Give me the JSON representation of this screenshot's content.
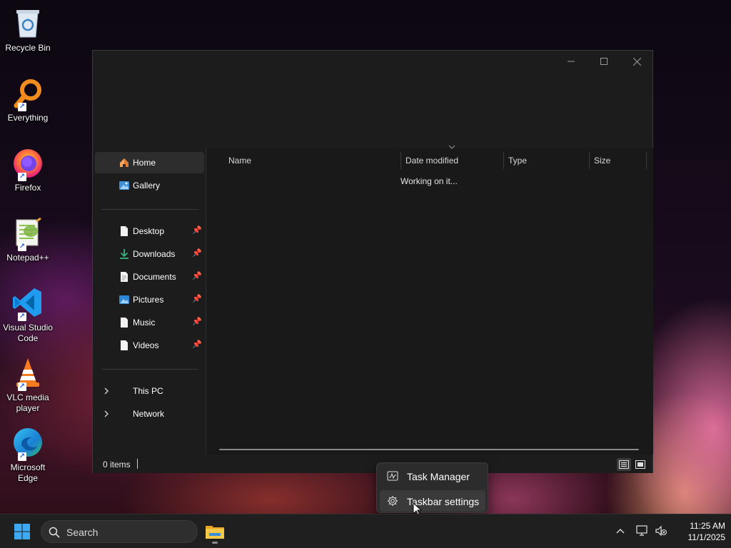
{
  "desktop": {
    "icons": [
      {
        "label": "Recycle Bin",
        "icon": "recycle-bin-icon"
      },
      {
        "label": "Everything",
        "icon": "everything-icon"
      },
      {
        "label": "Firefox",
        "icon": "firefox-icon"
      },
      {
        "label": "Notepad++",
        "icon": "notepad-plus-plus-icon"
      },
      {
        "label": "Visual Studio Code",
        "icon": "vscode-icon"
      },
      {
        "label": "VLC media player",
        "icon": "vlc-icon"
      },
      {
        "label": "Microsoft Edge",
        "icon": "edge-icon"
      }
    ]
  },
  "explorer": {
    "window_controls": [
      "minimize",
      "maximize",
      "close"
    ],
    "nav": {
      "top": [
        {
          "label": "Home",
          "icon": "home-icon",
          "selected": true
        },
        {
          "label": "Gallery",
          "icon": "gallery-icon"
        }
      ],
      "quick_access": [
        {
          "label": "Desktop",
          "icon": "desktop-folder-icon",
          "pinned": true
        },
        {
          "label": "Downloads",
          "icon": "download-icon",
          "pinned": true
        },
        {
          "label": "Documents",
          "icon": "documents-icon",
          "pinned": true
        },
        {
          "label": "Pictures",
          "icon": "pictures-icon",
          "pinned": true
        },
        {
          "label": "Music",
          "icon": "music-icon",
          "pinned": true
        },
        {
          "label": "Videos",
          "icon": "videos-icon",
          "pinned": true
        }
      ],
      "locations": [
        {
          "label": "This PC",
          "icon": "chevron-right-icon"
        },
        {
          "label": "Network",
          "icon": "chevron-right-icon"
        }
      ]
    },
    "columns": [
      "Name",
      "Date modified",
      "Type",
      "Size"
    ],
    "status_message": "Working on it...",
    "status_bar": {
      "item_count": "0 items"
    }
  },
  "context_menu": {
    "items": [
      {
        "label": "Task Manager",
        "icon": "task-manager-icon"
      },
      {
        "label": "Taskbar settings",
        "icon": "gear-icon",
        "hovered": true
      }
    ]
  },
  "taskbar": {
    "search_placeholder": "Search",
    "clock": {
      "time": "11:25 AM",
      "date": "11/1/2025"
    },
    "colors": {
      "accent": "#0078d4",
      "folder": "#f3c043"
    }
  }
}
